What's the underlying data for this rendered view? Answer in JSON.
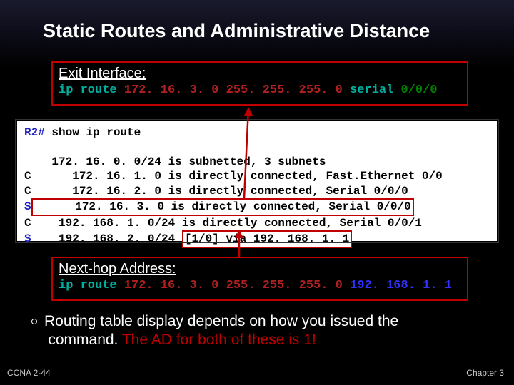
{
  "title": "Static Routes and Administrative Distance",
  "exit_interface": {
    "label": "Exit Interface:",
    "ip_route": "ip route ",
    "dest": "172. 16. 3. 0 255. 255. 255. 0 ",
    "serial_word": "serial",
    "serial_val": " 0/0/0"
  },
  "terminal": {
    "prompt": "R2# ",
    "show_cmd": "show ip route",
    "blank": "",
    "sub": "    172. 16. 0. 0/24 is subnetted, 3 subnets",
    "c1": "C      172. 16. 1. 0 is directly connected, Fast.Ethernet 0/0",
    "c2": "C      172. 16. 2. 0 is directly connected, Serial 0/0/0",
    "s1_code": "S",
    "s1_rest": "      172. 16. 3. 0 is directly connected, Serial 0/0/0",
    "c3": "C    192. 168. 1. 0/24 is directly connected, Serial 0/0/1",
    "s2_code": "S",
    "s2_pre": "    192. 168. 2. 0/24 ",
    "s2_via": "[1/0] via 192. 168. 1. 1"
  },
  "next_hop": {
    "label": "Next-hop Address:",
    "ip_route": "ip route ",
    "dest": "172. 16. 3. 0 255. 255. 255. 0 ",
    "addr": "192. 168. 1. 1"
  },
  "bullet": {
    "line1": "Routing table display depends on how you issued the",
    "line2a": "command.  ",
    "line2b": "The AD for both of these is 1!"
  },
  "footer": {
    "left": "CCNA 2-44",
    "right": "Chapter 3"
  }
}
